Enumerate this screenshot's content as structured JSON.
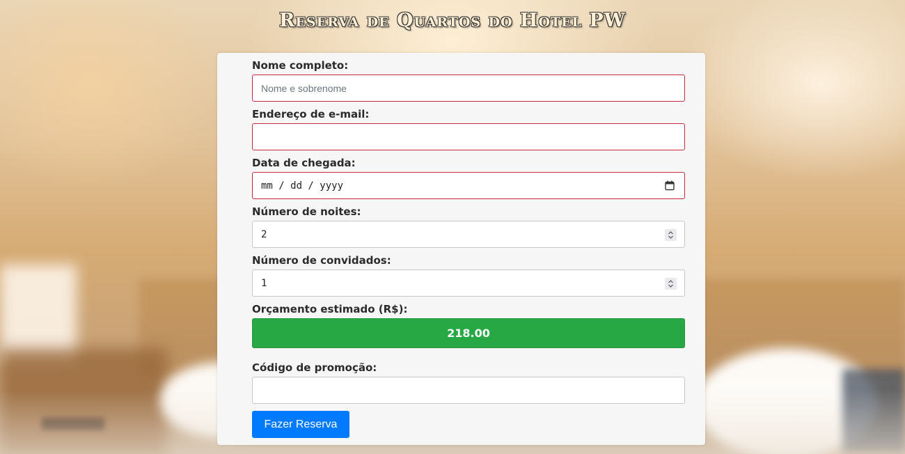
{
  "page": {
    "title": "Reserva de Quartos do Hotel PW"
  },
  "form": {
    "name": {
      "label": "Nome completo:",
      "placeholder": "Nome e sobrenome",
      "value": ""
    },
    "email": {
      "label": "Endereço de e-mail:",
      "value": ""
    },
    "arrival": {
      "label": "Data de chegada:",
      "placeholder": "mm / dd / yyyy",
      "value": ""
    },
    "nights": {
      "label": "Número de noites:",
      "value": "2"
    },
    "guests": {
      "label": "Número de convidados:",
      "value": "1"
    },
    "budget": {
      "label": "Orçamento estimado (R$):",
      "value": "218.00"
    },
    "promo": {
      "label": "Código de promoção:",
      "value": ""
    },
    "submit_label": "Fazer Reserva"
  },
  "colors": {
    "invalid_border": "#c8283c",
    "budget_bg": "#28a745",
    "button_bg": "#007bff"
  },
  "icons": {
    "calendar": "calendar-icon",
    "spinner": "spinner-arrows-icon"
  }
}
